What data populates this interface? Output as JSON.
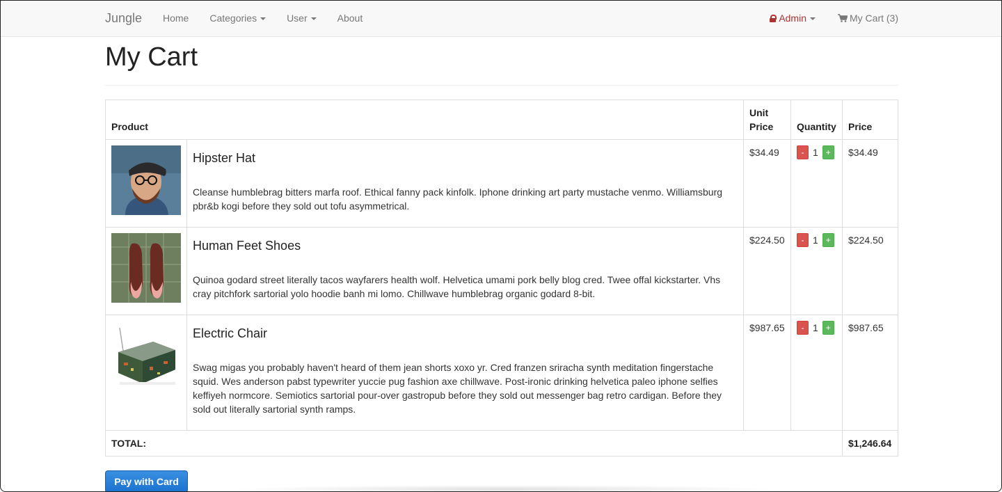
{
  "navbar": {
    "brand": "Jungle",
    "items": [
      {
        "label": "Home",
        "dropdown": false
      },
      {
        "label": "Categories",
        "dropdown": true
      },
      {
        "label": "User",
        "dropdown": true
      },
      {
        "label": "About",
        "dropdown": false
      }
    ],
    "admin_label": "Admin",
    "cart_label": "My Cart (3)"
  },
  "page": {
    "title": "My Cart"
  },
  "table": {
    "headers": {
      "product": "Product",
      "unit_price": "Unit Price",
      "quantity": "Quantity",
      "price": "Price"
    },
    "rows": [
      {
        "name": "Hipster Hat",
        "description": "Cleanse humblebrag bitters marfa roof. Ethical fanny pack kinfolk. Iphone drinking art party mustache venmo. Williamsburg pbr&b kogi before they sold out tofu asymmetrical.",
        "unit_price": "$34.49",
        "quantity": "1",
        "price": "$34.49",
        "image": "man-with-hat-photo"
      },
      {
        "name": "Human Feet Shoes",
        "description": "Quinoa godard street literally tacos wayfarers health wolf. Helvetica umami pork belly blog cred. Twee offal kickstarter. Vhs cray pitchfork sartorial yolo hoodie banh mi lomo. Chillwave humblebrag organic godard 8-bit.",
        "unit_price": "$224.50",
        "quantity": "1",
        "price": "$224.50",
        "image": "feet-shoes-photo"
      },
      {
        "name": "Electric Chair",
        "description": "Swag migas you probably haven't heard of them jean shorts xoxo yr. Cred franzen sriracha synth meditation fingerstache squid. Wes anderson pabst typewriter yuccie pug fashion axe chillwave. Post-ironic drinking helvetica paleo iphone selfies keffiyeh normcore. Semiotics sartorial pour-over gastropub before they sold out messenger bag retro cardigan. Before they sold out literally sartorial synth ramps.",
        "unit_price": "$987.65",
        "quantity": "1",
        "price": "$987.65",
        "image": "circuit-board-chair-photo"
      }
    ],
    "minus_label": "-",
    "plus_label": "+",
    "total_label": "TOTAL:",
    "total_value": "$1,246.64"
  },
  "pay_button": "Pay with Card",
  "colors": {
    "minus": "#d9534f",
    "plus": "#5cb85c",
    "admin": "#a33333",
    "pay": "#1a73d0"
  }
}
